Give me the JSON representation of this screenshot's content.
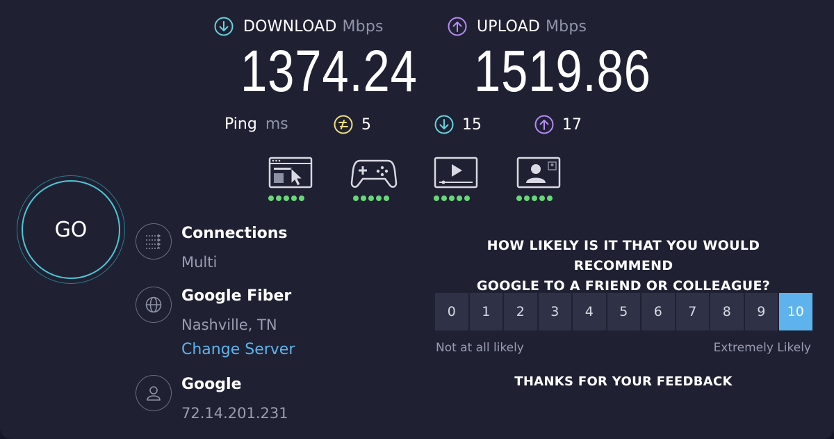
{
  "download": {
    "label": "DOWNLOAD",
    "unit": "Mbps",
    "value": "1374.24"
  },
  "upload": {
    "label": "UPLOAD",
    "unit": "Mbps",
    "value": "1519.86"
  },
  "ping": {
    "label": "Ping",
    "unit": "ms",
    "idle": "5",
    "download": "15",
    "upload": "17"
  },
  "activities": [
    {
      "icon": "web-browsing-icon",
      "rating": 5
    },
    {
      "icon": "gaming-icon",
      "rating": 5
    },
    {
      "icon": "video-streaming-icon",
      "rating": 5
    },
    {
      "icon": "video-chat-icon",
      "rating": 5
    }
  ],
  "go_label": "GO",
  "connections": {
    "title": "Connections",
    "value": "Multi"
  },
  "server": {
    "title": "Google Fiber",
    "location": "Nashville, TN",
    "change_link": "Change Server"
  },
  "provider": {
    "title": "Google",
    "ip": "72.14.201.231"
  },
  "survey": {
    "question_line1": "HOW LIKELY IS IT THAT YOU WOULD RECOMMEND",
    "question_line2": "GOOGLE TO A FRIEND OR COLLEAGUE?",
    "scale": [
      "0",
      "1",
      "2",
      "3",
      "4",
      "5",
      "6",
      "7",
      "8",
      "9",
      "10"
    ],
    "selected": "10",
    "low_label": "Not at all likely",
    "high_label": "Extremely Likely",
    "thanks": "THANKS FOR YOUR FEEDBACK"
  },
  "colors": {
    "background": "#1f2133",
    "download_accent": "#6ad3df",
    "upload_accent": "#b98bf5",
    "ping_accent": "#f2e07a",
    "link": "#5eb3ec",
    "rating_dot": "#6ad67a",
    "selected_score": "#5eb3ec"
  }
}
